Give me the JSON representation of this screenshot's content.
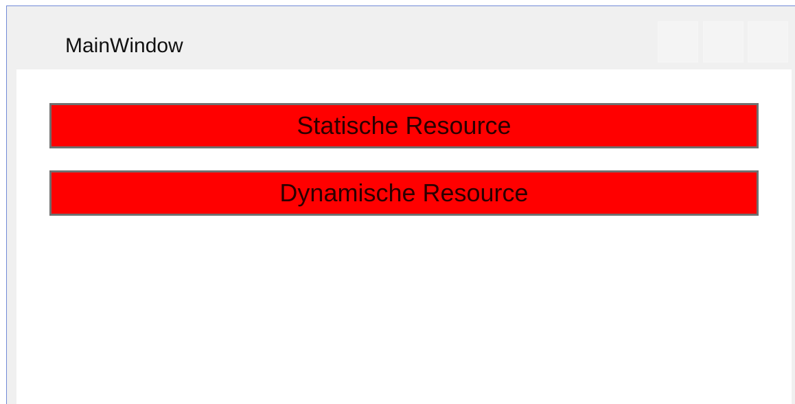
{
  "window": {
    "title": "MainWindow",
    "caption_buttons": [
      {
        "name": "minimize",
        "icon": "minimize-icon"
      },
      {
        "name": "maximize",
        "icon": "maximize-icon"
      },
      {
        "name": "close",
        "icon": "close-icon"
      }
    ]
  },
  "content": {
    "static_button_label": "Statische Resource",
    "dynamic_button_label": "Dynamische Resource"
  },
  "colors": {
    "button_background": "#ff0000",
    "button_border": "#707070",
    "titlebar_background": "#f0f0f0",
    "window_border": "#6f88d6",
    "client_background": "#ffffff"
  }
}
